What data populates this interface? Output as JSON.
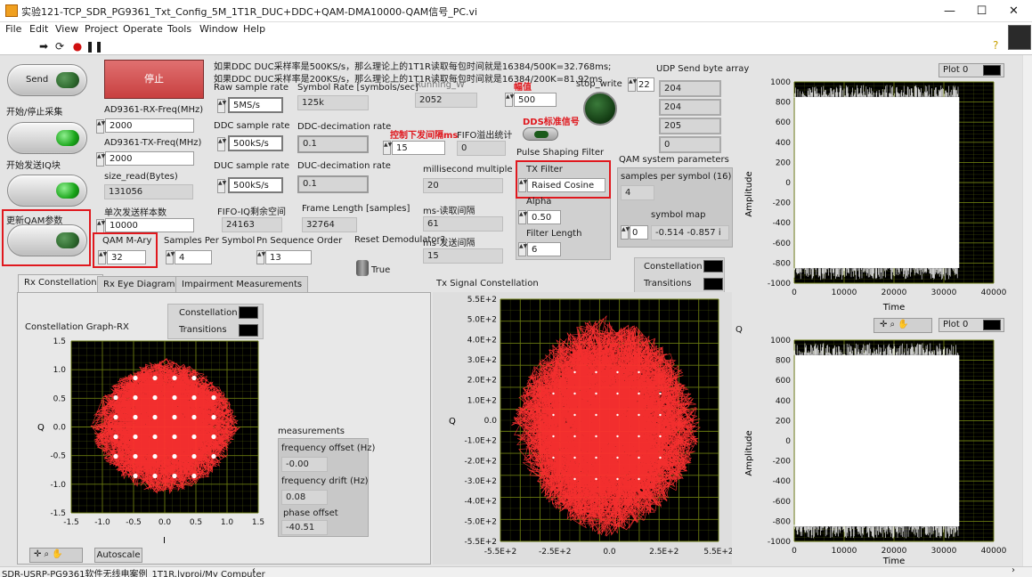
{
  "window": {
    "title": "实验121-TCP_SDR_PG9361_Txt_Config_5M_1T1R_DUC+DDC+QAM-DMA10000-QAM信号_PC.vi",
    "minimize": "—",
    "maximize": "☐",
    "close": "✕"
  },
  "menu": [
    "File",
    "Edit",
    "View",
    "Project",
    "Operate",
    "Tools",
    "Window",
    "Help"
  ],
  "toolbar_icons": [
    "run-arrow-icon",
    "run-continuous-icon",
    "abort-icon",
    "pause-icon"
  ],
  "buttons": {
    "send": "Send",
    "send_caption": "开始/停止采集",
    "send_iq_caption": "开始发送IQ块",
    "update_qam_caption": "更新QAM参数",
    "stop": "停止"
  },
  "notes": {
    "line1": "如果DDC DUC采样率是500KS/s，那么理论上的1T1R读取每包时间就是16384/500K=32.768ms;",
    "line2": "如果DDC DUC采样率是200KS/s，那么理论上的1T1R读取每包时间就是16384/200K=81.92ms"
  },
  "fields": {
    "rx_freq": {
      "label": "AD9361-RX-Freq(MHz)",
      "value": "2000"
    },
    "tx_freq": {
      "label": "AD9361-TX-Freq(MHz)",
      "value": "2000"
    },
    "size_read": {
      "label": "size_read(Bytes)",
      "value": "131056"
    },
    "samples_per_send": {
      "label": "单次发送样本数",
      "value": "10000"
    },
    "qam_mary": {
      "label": "QAM M-Ary",
      "value": "32"
    },
    "samples_per_symbol": {
      "label": "Samples Per Symbol",
      "value": "4"
    },
    "pn_order": {
      "label": "Pn Sequence Order",
      "value": "13"
    },
    "raw_rate": {
      "label": "Raw sample rate",
      "value": "5MS/s"
    },
    "ddc_rate": {
      "label": "DDC sample rate",
      "value": "500kS/s"
    },
    "duc_rate": {
      "label": "DUC sample rate",
      "value": "500kS/s"
    },
    "fifo_remaining": {
      "label": "FIFO-IQ剩余空间",
      "value": "24163"
    },
    "symbol_rate": {
      "label": "Symbol Rate [symbols/sec]",
      "value": "125k"
    },
    "running_w": {
      "label": "Running_W",
      "value": "2052"
    },
    "ddc_decim": {
      "label": "DDC-decimation rate",
      "value": "0.1"
    },
    "duc_decim": {
      "label": "DUC-decimation rate",
      "value": "0.1"
    },
    "frame_length": {
      "label": "Frame Length [samples]",
      "value": "32764"
    },
    "send_interval_ctl": {
      "label": "控制下发间隔ms",
      "value": "15"
    },
    "fifo_overflow": {
      "label": "FIFO溢出统计",
      "value": "0"
    },
    "ms_multiple": {
      "label": "millisecond multiple",
      "value": "20"
    },
    "ms_read": {
      "label": "ms-读取间隔",
      "value": "61"
    },
    "ms_send": {
      "label": "ms-发送间隔",
      "value": "15"
    },
    "amplitude": {
      "label": "幅值",
      "value": "500"
    },
    "stop_write": {
      "label": "stop_write"
    },
    "dds_label": "DDS标准信号",
    "reset_demod": {
      "label": "Reset Demodulator?",
      "value": "True"
    },
    "udp_label": "UDP Send byte array",
    "udp_index": "22",
    "udp_values": [
      "204",
      "204",
      "205",
      "0"
    ]
  },
  "pulse_shaping": {
    "title": "Pulse Shaping Filter",
    "tx_filter_label": "TX Filter",
    "tx_filter_value": "Raised Cosine",
    "alpha_label": "Alpha",
    "alpha_value": "0.50",
    "filter_len_label": "Filter Length",
    "filter_len_value": "6"
  },
  "qam_params": {
    "title": "QAM system parameters",
    "sps_label": "samples per symbol (16)",
    "sps_value": "4",
    "symbol_map_label": "symbol map",
    "symbol_map_index": "0",
    "symbol_map_value": "-0.514 -0.857 i"
  },
  "tabs": [
    "Rx Constellation",
    "Rx Eye Diagram",
    "Impairment Measurements"
  ],
  "rx_constellation": {
    "title": "Constellation Graph-RX",
    "legend": [
      "Constellation",
      "Transitions"
    ],
    "xlabel": "I",
    "ylabel": "Q",
    "xticks": [
      "-1.5",
      "-1.0",
      "-0.5",
      "0.0",
      "0.5",
      "1.0",
      "1.5"
    ],
    "yticks": [
      "1.5",
      "1.0",
      "0.5",
      "0.0",
      "-0.5",
      "-1.0",
      "-1.5"
    ],
    "autoscale": "Autoscale"
  },
  "measurements": {
    "title": "measurements",
    "freq_offset_label": "frequency offset (Hz)",
    "freq_offset_value": "-0.00",
    "freq_drift_label": "frequency drift (Hz)",
    "freq_drift_value": "0.08",
    "phase_offset_label": "phase offset",
    "phase_offset_value": "-40.51"
  },
  "tx_constellation": {
    "title": "Tx Signal Constellation",
    "legend": [
      "Constellation",
      "Transitions"
    ],
    "ylabel": "Q",
    "xticks": [
      "-5.5E+2",
      "-2.5E+2",
      "0.0",
      "2.5E+2",
      "5.5E+2"
    ],
    "yticks": [
      "5.5E+2",
      "5.0E+2",
      "4.0E+2",
      "3.0E+2",
      "2.0E+2",
      "1.0E+2",
      "0.0",
      "-1.0E+2",
      "-2.0E+2",
      "-3.0E+2",
      "-4.0E+2",
      "-5.0E+2",
      "-5.5E+2"
    ]
  },
  "waveform_i": {
    "plot_label": "Plot 0",
    "xlabel": "Time",
    "ylabel": "Amplitude",
    "xticks": [
      "0",
      "10000",
      "20000",
      "30000",
      "40000"
    ],
    "yticks": [
      "1000",
      "800",
      "600",
      "400",
      "200",
      "0",
      "-200",
      "-400",
      "-600",
      "-800",
      "-1000"
    ]
  },
  "waveform_q": {
    "side_label": "Q",
    "plot_label": "Plot 0",
    "xlabel": "Time",
    "ylabel": "Amplitude",
    "xticks": [
      "0",
      "10000",
      "20000",
      "30000",
      "40000"
    ],
    "yticks": [
      "1000",
      "800",
      "600",
      "400",
      "200",
      "0",
      "-200",
      "-400",
      "-600",
      "-800",
      "-1000"
    ]
  },
  "status": {
    "project": "SDR-USRP-PG9361软件无线电案例_1T1R.lvproj/My Computer"
  },
  "colors": {
    "plot_red": "#ff3030",
    "grid": "#6a7a10",
    "highlight": "#e0181e",
    "led_green": "#1aa51a"
  }
}
